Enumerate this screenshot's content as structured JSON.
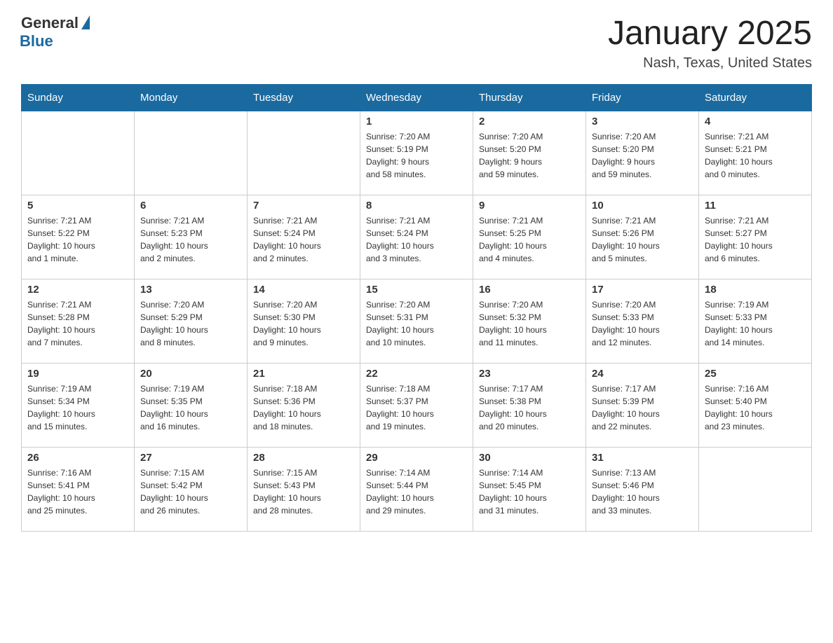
{
  "header": {
    "logo_general": "General",
    "logo_blue": "Blue",
    "month_title": "January 2025",
    "location": "Nash, Texas, United States"
  },
  "weekdays": [
    "Sunday",
    "Monday",
    "Tuesday",
    "Wednesday",
    "Thursday",
    "Friday",
    "Saturday"
  ],
  "weeks": [
    [
      {
        "day": "",
        "info": ""
      },
      {
        "day": "",
        "info": ""
      },
      {
        "day": "",
        "info": ""
      },
      {
        "day": "1",
        "info": "Sunrise: 7:20 AM\nSunset: 5:19 PM\nDaylight: 9 hours\nand 58 minutes."
      },
      {
        "day": "2",
        "info": "Sunrise: 7:20 AM\nSunset: 5:20 PM\nDaylight: 9 hours\nand 59 minutes."
      },
      {
        "day": "3",
        "info": "Sunrise: 7:20 AM\nSunset: 5:20 PM\nDaylight: 9 hours\nand 59 minutes."
      },
      {
        "day": "4",
        "info": "Sunrise: 7:21 AM\nSunset: 5:21 PM\nDaylight: 10 hours\nand 0 minutes."
      }
    ],
    [
      {
        "day": "5",
        "info": "Sunrise: 7:21 AM\nSunset: 5:22 PM\nDaylight: 10 hours\nand 1 minute."
      },
      {
        "day": "6",
        "info": "Sunrise: 7:21 AM\nSunset: 5:23 PM\nDaylight: 10 hours\nand 2 minutes."
      },
      {
        "day": "7",
        "info": "Sunrise: 7:21 AM\nSunset: 5:24 PM\nDaylight: 10 hours\nand 2 minutes."
      },
      {
        "day": "8",
        "info": "Sunrise: 7:21 AM\nSunset: 5:24 PM\nDaylight: 10 hours\nand 3 minutes."
      },
      {
        "day": "9",
        "info": "Sunrise: 7:21 AM\nSunset: 5:25 PM\nDaylight: 10 hours\nand 4 minutes."
      },
      {
        "day": "10",
        "info": "Sunrise: 7:21 AM\nSunset: 5:26 PM\nDaylight: 10 hours\nand 5 minutes."
      },
      {
        "day": "11",
        "info": "Sunrise: 7:21 AM\nSunset: 5:27 PM\nDaylight: 10 hours\nand 6 minutes."
      }
    ],
    [
      {
        "day": "12",
        "info": "Sunrise: 7:21 AM\nSunset: 5:28 PM\nDaylight: 10 hours\nand 7 minutes."
      },
      {
        "day": "13",
        "info": "Sunrise: 7:20 AM\nSunset: 5:29 PM\nDaylight: 10 hours\nand 8 minutes."
      },
      {
        "day": "14",
        "info": "Sunrise: 7:20 AM\nSunset: 5:30 PM\nDaylight: 10 hours\nand 9 minutes."
      },
      {
        "day": "15",
        "info": "Sunrise: 7:20 AM\nSunset: 5:31 PM\nDaylight: 10 hours\nand 10 minutes."
      },
      {
        "day": "16",
        "info": "Sunrise: 7:20 AM\nSunset: 5:32 PM\nDaylight: 10 hours\nand 11 minutes."
      },
      {
        "day": "17",
        "info": "Sunrise: 7:20 AM\nSunset: 5:33 PM\nDaylight: 10 hours\nand 12 minutes."
      },
      {
        "day": "18",
        "info": "Sunrise: 7:19 AM\nSunset: 5:33 PM\nDaylight: 10 hours\nand 14 minutes."
      }
    ],
    [
      {
        "day": "19",
        "info": "Sunrise: 7:19 AM\nSunset: 5:34 PM\nDaylight: 10 hours\nand 15 minutes."
      },
      {
        "day": "20",
        "info": "Sunrise: 7:19 AM\nSunset: 5:35 PM\nDaylight: 10 hours\nand 16 minutes."
      },
      {
        "day": "21",
        "info": "Sunrise: 7:18 AM\nSunset: 5:36 PM\nDaylight: 10 hours\nand 18 minutes."
      },
      {
        "day": "22",
        "info": "Sunrise: 7:18 AM\nSunset: 5:37 PM\nDaylight: 10 hours\nand 19 minutes."
      },
      {
        "day": "23",
        "info": "Sunrise: 7:17 AM\nSunset: 5:38 PM\nDaylight: 10 hours\nand 20 minutes."
      },
      {
        "day": "24",
        "info": "Sunrise: 7:17 AM\nSunset: 5:39 PM\nDaylight: 10 hours\nand 22 minutes."
      },
      {
        "day": "25",
        "info": "Sunrise: 7:16 AM\nSunset: 5:40 PM\nDaylight: 10 hours\nand 23 minutes."
      }
    ],
    [
      {
        "day": "26",
        "info": "Sunrise: 7:16 AM\nSunset: 5:41 PM\nDaylight: 10 hours\nand 25 minutes."
      },
      {
        "day": "27",
        "info": "Sunrise: 7:15 AM\nSunset: 5:42 PM\nDaylight: 10 hours\nand 26 minutes."
      },
      {
        "day": "28",
        "info": "Sunrise: 7:15 AM\nSunset: 5:43 PM\nDaylight: 10 hours\nand 28 minutes."
      },
      {
        "day": "29",
        "info": "Sunrise: 7:14 AM\nSunset: 5:44 PM\nDaylight: 10 hours\nand 29 minutes."
      },
      {
        "day": "30",
        "info": "Sunrise: 7:14 AM\nSunset: 5:45 PM\nDaylight: 10 hours\nand 31 minutes."
      },
      {
        "day": "31",
        "info": "Sunrise: 7:13 AM\nSunset: 5:46 PM\nDaylight: 10 hours\nand 33 minutes."
      },
      {
        "day": "",
        "info": ""
      }
    ]
  ]
}
